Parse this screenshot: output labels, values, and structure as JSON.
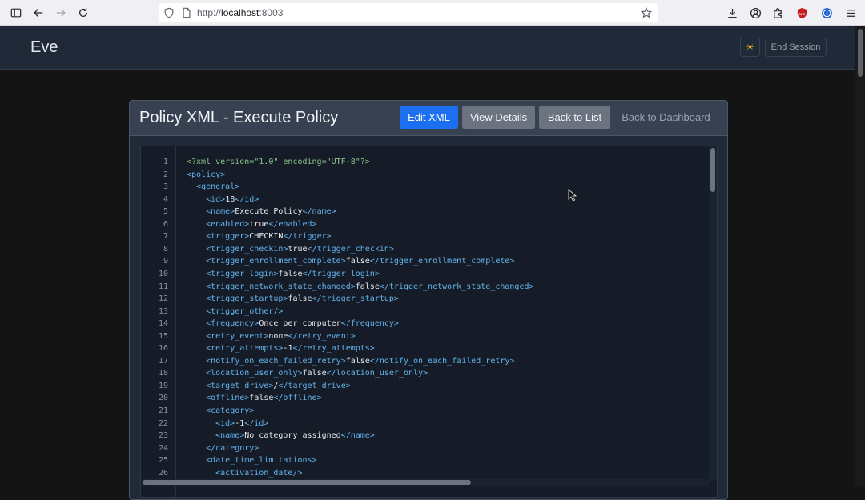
{
  "browser": {
    "url_scheme": "http://",
    "url_host": "localhost",
    "url_rest": ":8003"
  },
  "header": {
    "brand": "Eve",
    "end_session_label": "End Session",
    "theme_icon": "sun-icon"
  },
  "card": {
    "title": "Policy XML - Execute Policy",
    "buttons": {
      "edit_xml": "Edit XML",
      "view_details": "View Details",
      "back_to_list": "Back to List",
      "back_to_dashboard": "Back to Dashboard"
    }
  },
  "editor": {
    "lines": [
      {
        "n": "1",
        "indent": "",
        "open": "",
        "text": "",
        "close": "",
        "pi": "<?xml version=\"1.0\" encoding=\"UTF-8\"?>"
      },
      {
        "n": "2",
        "indent": "",
        "open": "<policy>",
        "text": "",
        "close": ""
      },
      {
        "n": "3",
        "indent": "  ",
        "open": "<general>",
        "text": "",
        "close": ""
      },
      {
        "n": "4",
        "indent": "    ",
        "open": "<id>",
        "text": "18",
        "close": "</id>"
      },
      {
        "n": "5",
        "indent": "    ",
        "open": "<name>",
        "text": "Execute Policy",
        "close": "</name>"
      },
      {
        "n": "6",
        "indent": "    ",
        "open": "<enabled>",
        "text": "true",
        "close": "</enabled>"
      },
      {
        "n": "7",
        "indent": "    ",
        "open": "<trigger>",
        "text": "CHECKIN",
        "close": "</trigger>"
      },
      {
        "n": "8",
        "indent": "    ",
        "open": "<trigger_checkin>",
        "text": "true",
        "close": "</trigger_checkin>"
      },
      {
        "n": "9",
        "indent": "    ",
        "open": "<trigger_enrollment_complete>",
        "text": "false",
        "close": "</trigger_enrollment_complete>"
      },
      {
        "n": "10",
        "indent": "    ",
        "open": "<trigger_login>",
        "text": "false",
        "close": "</trigger_login>"
      },
      {
        "n": "11",
        "indent": "    ",
        "open": "<trigger_network_state_changed>",
        "text": "false",
        "close": "</trigger_network_state_changed>"
      },
      {
        "n": "12",
        "indent": "    ",
        "open": "<trigger_startup>",
        "text": "false",
        "close": "</trigger_startup>"
      },
      {
        "n": "13",
        "indent": "    ",
        "open": "<trigger_other/>",
        "text": "",
        "close": ""
      },
      {
        "n": "14",
        "indent": "    ",
        "open": "<frequency>",
        "text": "Once per computer",
        "close": "</frequency>"
      },
      {
        "n": "15",
        "indent": "    ",
        "open": "<retry_event>",
        "text": "none",
        "close": "</retry_event>"
      },
      {
        "n": "16",
        "indent": "    ",
        "open": "<retry_attempts>",
        "text": "-1",
        "close": "</retry_attempts>"
      },
      {
        "n": "17",
        "indent": "    ",
        "open": "<notify_on_each_failed_retry>",
        "text": "false",
        "close": "</notify_on_each_failed_retry>"
      },
      {
        "n": "18",
        "indent": "    ",
        "open": "<location_user_only>",
        "text": "false",
        "close": "</location_user_only>"
      },
      {
        "n": "19",
        "indent": "    ",
        "open": "<target_drive>",
        "text": "/",
        "close": "</target_drive>"
      },
      {
        "n": "20",
        "indent": "    ",
        "open": "<offline>",
        "text": "false",
        "close": "</offline>"
      },
      {
        "n": "21",
        "indent": "    ",
        "open": "<category>",
        "text": "",
        "close": ""
      },
      {
        "n": "22",
        "indent": "      ",
        "open": "<id>",
        "text": "-1",
        "close": "</id>"
      },
      {
        "n": "23",
        "indent": "      ",
        "open": "<name>",
        "text": "No category assigned",
        "close": "</name>"
      },
      {
        "n": "24",
        "indent": "    ",
        "open": "</category>",
        "text": "",
        "close": ""
      },
      {
        "n": "25",
        "indent": "    ",
        "open": "<date_time_limitations>",
        "text": "",
        "close": ""
      },
      {
        "n": "26",
        "indent": "      ",
        "open": "<activation_date/>",
        "text": "",
        "close": ""
      }
    ]
  }
}
